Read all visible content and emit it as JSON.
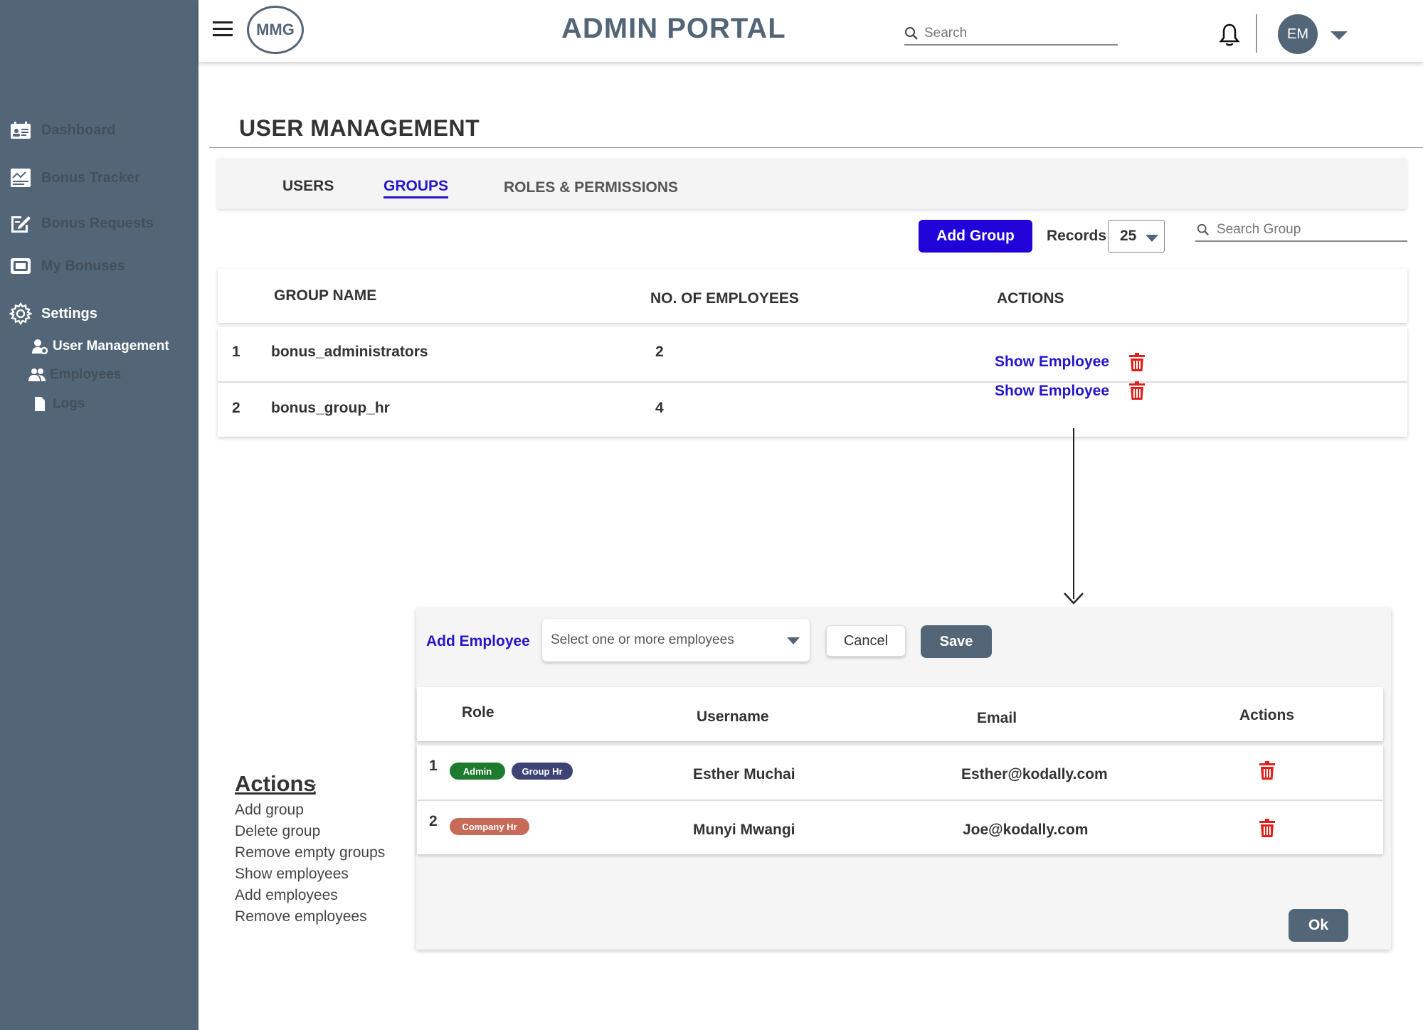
{
  "sidebar": {
    "items": [
      {
        "label": "Dashboard",
        "icon": "dashboard-icon"
      },
      {
        "label": "Bonus Tracker",
        "icon": "chart-icon"
      },
      {
        "label": "Bonus Requests",
        "icon": "edit-document-icon"
      },
      {
        "label": "My Bonuses",
        "icon": "wallet-icon"
      },
      {
        "label": "Settings",
        "icon": "gear-icon"
      }
    ],
    "sub_items": [
      {
        "label": "User Management",
        "icon": "user-gear-icon"
      },
      {
        "label": "Employees",
        "icon": "people-icon"
      },
      {
        "label": "Logs",
        "icon": "file-icon"
      }
    ]
  },
  "header": {
    "logo": "MMG",
    "title": "ADMIN PORTAL",
    "search_placeholder": "Search",
    "avatar_initials": "EM"
  },
  "page": {
    "title": "USER MANAGEMENT",
    "tabs": [
      "USERS",
      "GROUPS",
      "ROLES & PERMISSIONS"
    ],
    "active_tab": "GROUPS"
  },
  "toolbar": {
    "add_group_label": "Add Group",
    "records_label": "Records",
    "records_value": "25",
    "search_placeholder": "Search Group"
  },
  "groups_table": {
    "headers": [
      "GROUP NAME",
      "NO. OF EMPLOYEES",
      "ACTIONS"
    ],
    "rows": [
      {
        "index": "1",
        "name": "bonus_administrators",
        "count": "2",
        "action": "Show Employee"
      },
      {
        "index": "2",
        "name": "bonus_group_hr",
        "count": "4",
        "action": "Show Employee"
      }
    ]
  },
  "modal": {
    "add_employee_label": "Add Employee",
    "select_placeholder": "Select one or more employees",
    "cancel_label": "Cancel",
    "save_label": "Save",
    "headers": [
      "Role",
      "Username",
      "Email",
      "Actions"
    ],
    "rows": [
      {
        "index": "1",
        "roles": [
          "Admin",
          "Group Hr"
        ],
        "username": "Esther Muchai",
        "email": "Esther@kodally.com"
      },
      {
        "index": "2",
        "roles": [
          "Company Hr"
        ],
        "username": "Munyi Mwangi",
        "email": "Joe@kodally.com"
      }
    ],
    "ok_label": "Ok"
  },
  "notes": {
    "title": "Actions",
    "colon": ":",
    "items": [
      "Add group",
      "Delete group",
      "Remove empty groups",
      "Show employees",
      "Add employees",
      "Remove employees"
    ]
  },
  "colors": {
    "sidebar": "#536677",
    "primary": "#2003d8",
    "link": "#2515c9",
    "danger": "#e0201b",
    "badge_admin": "#1e7a2e",
    "badge_group_hr": "#3d4374",
    "badge_company_hr": "#c86a58"
  }
}
